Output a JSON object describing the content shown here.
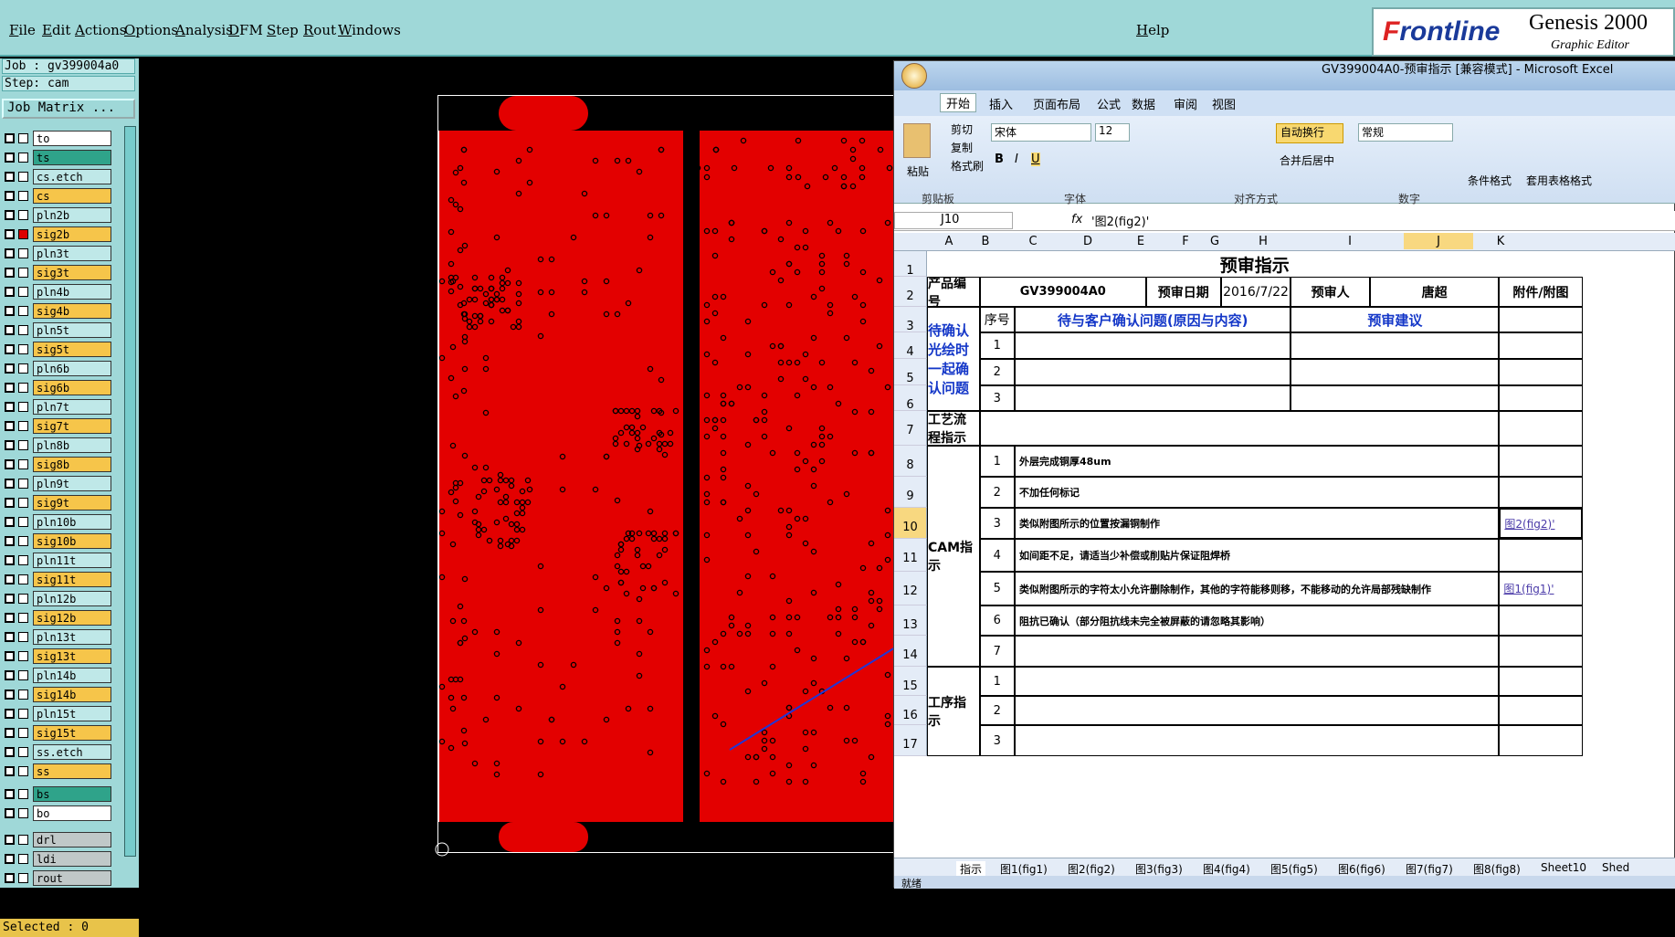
{
  "menu": {
    "file": "File",
    "edit": "Edit",
    "actions": "Actions",
    "options": "Options",
    "analysis": "Analysis",
    "dfm": "DFM",
    "step": "Step",
    "rout": "Rout",
    "windows": "Windows",
    "help": "Help"
  },
  "brand": {
    "logo_f": "F",
    "logo_rest": "rontline",
    "genesis": "Genesis 2000",
    "editor": "Graphic Editor",
    "corner": "25"
  },
  "job": {
    "job": "Job : gv399004a0",
    "step": "Step: cam",
    "matrix": "Job Matrix ...",
    "selected": "Selected : 0"
  },
  "layers": [
    {
      "name": "to",
      "color": "#ffffff"
    },
    {
      "name": "ts",
      "color": "#2fa38a"
    },
    {
      "name": "cs.etch",
      "color": "#bfe8e8"
    },
    {
      "name": "cs",
      "color": "#f6c54a"
    },
    {
      "name": "pln2b",
      "color": "#bfe8e8"
    },
    {
      "name": "sig2b",
      "color": "#f6c54a"
    },
    {
      "name": "pln3t",
      "color": "#bfe8e8"
    },
    {
      "name": "sig3t",
      "color": "#f6c54a"
    },
    {
      "name": "pln4b",
      "color": "#bfe8e8"
    },
    {
      "name": "sig4b",
      "color": "#f6c54a"
    },
    {
      "name": "pln5t",
      "color": "#bfe8e8"
    },
    {
      "name": "sig5t",
      "color": "#f6c54a"
    },
    {
      "name": "pln6b",
      "color": "#bfe8e8"
    },
    {
      "name": "sig6b",
      "color": "#f6c54a"
    },
    {
      "name": "pln7t",
      "color": "#bfe8e8"
    },
    {
      "name": "sig7t",
      "color": "#f6c54a"
    },
    {
      "name": "pln8b",
      "color": "#bfe8e8"
    },
    {
      "name": "sig8b",
      "color": "#f6c54a"
    },
    {
      "name": "pln9t",
      "color": "#bfe8e8"
    },
    {
      "name": "sig9t",
      "color": "#f6c54a"
    },
    {
      "name": "pln10b",
      "color": "#bfe8e8"
    },
    {
      "name": "sig10b",
      "color": "#f6c54a"
    },
    {
      "name": "pln11t",
      "color": "#bfe8e8"
    },
    {
      "name": "sig11t",
      "color": "#f6c54a"
    },
    {
      "name": "pln12b",
      "color": "#bfe8e8"
    },
    {
      "name": "sig12b",
      "color": "#f6c54a"
    },
    {
      "name": "pln13t",
      "color": "#bfe8e8"
    },
    {
      "name": "sig13t",
      "color": "#f6c54a"
    },
    {
      "name": "pln14b",
      "color": "#bfe8e8"
    },
    {
      "name": "sig14b",
      "color": "#f6c54a"
    },
    {
      "name": "pln15t",
      "color": "#bfe8e8"
    },
    {
      "name": "sig15t",
      "color": "#f6c54a"
    },
    {
      "name": "ss.etch",
      "color": "#bfe8e8"
    },
    {
      "name": "ss",
      "color": "#f6c54a"
    },
    {
      "name": "bs",
      "color": "#2fa38a"
    },
    {
      "name": "bo",
      "color": "#ffffff"
    },
    {
      "name": "drl",
      "color": "#c0c8c8"
    },
    {
      "name": "ldi",
      "color": "#c0c8c8"
    },
    {
      "name": "rout",
      "color": "#c0c8c8"
    }
  ],
  "excel": {
    "title": "GV399004A0-预审指示  [兼容模式] - Microsoft Excel",
    "tabs": [
      "开始",
      "插入",
      "页面布局",
      "公式",
      "数据",
      "审阅",
      "视图"
    ],
    "ribbon": {
      "cut": "剪切",
      "copy": "复制",
      "format_painter": "格式刷",
      "paste": "粘贴",
      "font": "宋体",
      "size": "12",
      "wrap": "自动换行",
      "merge": "合并后居中",
      "number_format": "常规",
      "cond": "条件格式",
      "table": "套用表格格式",
      "g_clip": "剪贴板",
      "g_font": "字体",
      "g_align": "对齐方式",
      "g_num": "数字"
    },
    "namebox": "J10",
    "formula": "'图2(fig2)'",
    "cols": [
      "A",
      "B",
      "C",
      "D",
      "E",
      "F",
      "G",
      "H",
      "I",
      "J",
      "K"
    ],
    "rows": [
      "1",
      "2",
      "3",
      "4",
      "5",
      "6",
      "7",
      "8",
      "9",
      "10",
      "11",
      "12",
      "13",
      "14",
      "15",
      "16",
      "17"
    ],
    "sheet_title": "预审指示",
    "product_label": "产品编号",
    "product": "GV399004A0",
    "date_label": "预审日期",
    "date": "2016/7/22",
    "reviewer_label": "预审人",
    "reviewer": "唐超",
    "attach_label": "附件/附图",
    "seq": "序号",
    "issue_head": "待与客户确认问题(原因与内容)",
    "advice_head": "预审建议",
    "confirm_label": "待确认光绘时一起确认问题",
    "process_label": "工艺流程指示",
    "cam_label": "CAM指示",
    "proc_label": "工序指示",
    "cam_items": [
      "外层完成铜厚48um",
      "不加任何标记",
      "类似附图所示的位置按漏铜制作",
      "如间距不足，请适当少补偿或削贴片保证阻焊桥",
      "类似附图所示的字符太小允许删除制作，其他的字符能移则移，不能移动的允许局部残缺制作",
      "阻抗已确认（部分阻抗线未完全被屏蔽的请忽略其影响）",
      ""
    ],
    "link_fig2": "图2(fig2)'",
    "link_fig1": "图1(fig1)'",
    "sheet_tabs": [
      "指示",
      "图1(fig1)",
      "图2(fig2)",
      "图3(fig3)",
      "图4(fig4)",
      "图5(fig5)",
      "图6(fig6)",
      "图7(fig7)",
      "图8(fig8)",
      "Sheet10",
      "Shed"
    ],
    "status": "就绪"
  }
}
